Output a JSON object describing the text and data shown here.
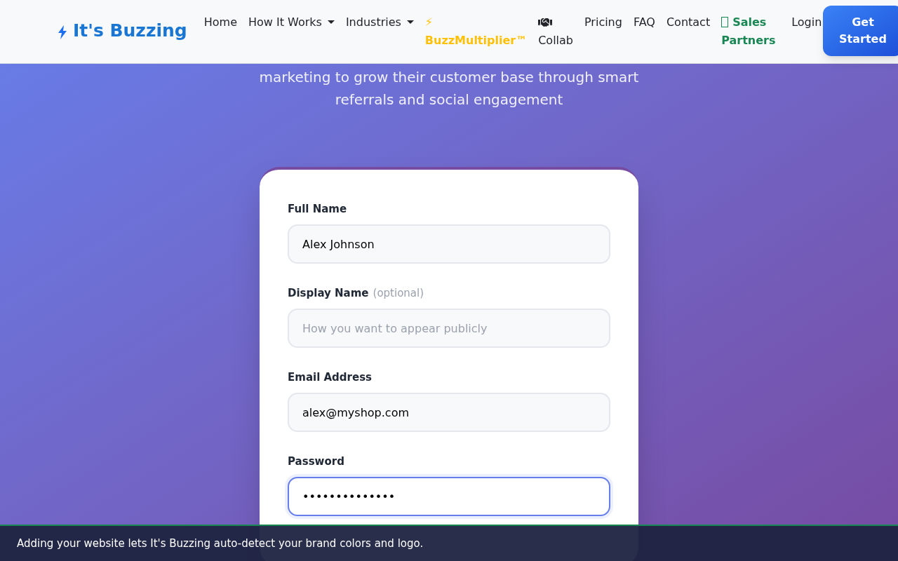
{
  "nav": {
    "brand": "It's Buzzing",
    "items": [
      {
        "kind": "link",
        "label": "Home"
      },
      {
        "kind": "dropdown",
        "label": "How It Works"
      },
      {
        "kind": "dropdown",
        "label": "Industries"
      },
      {
        "kind": "highlight",
        "prefix": "⚡",
        "label": "BuzzMultiplier™",
        "color": "#ffc107"
      },
      {
        "kind": "handshake",
        "label": "Collab"
      },
      {
        "kind": "link",
        "label": "Pricing"
      },
      {
        "kind": "link",
        "label": "FAQ"
      },
      {
        "kind": "link",
        "label": "Contact"
      },
      {
        "kind": "missing-glyph",
        "label": "Sales Partners",
        "color": "#198754"
      },
      {
        "kind": "link",
        "label": "Login"
      }
    ],
    "cta": "Get Started"
  },
  "hero": {
    "lines": [
      "marketing to grow their customer base through smart",
      "referrals and social engagement"
    ]
  },
  "form": {
    "fields": [
      {
        "label": "Full Name",
        "value": "Alex Johnson",
        "focused": false
      },
      {
        "label": "Display Name",
        "note": "(optional)",
        "placeholder": "How you want to appear publicly",
        "focused": false
      },
      {
        "label": "Email Address",
        "value": "alex@myshop.com",
        "focused": false
      },
      {
        "label": "Password",
        "value": "••••••••••••••",
        "focused": true
      }
    ]
  },
  "toast": {
    "message": "Adding your website lets It's Buzzing auto-detect your brand colors and logo."
  }
}
